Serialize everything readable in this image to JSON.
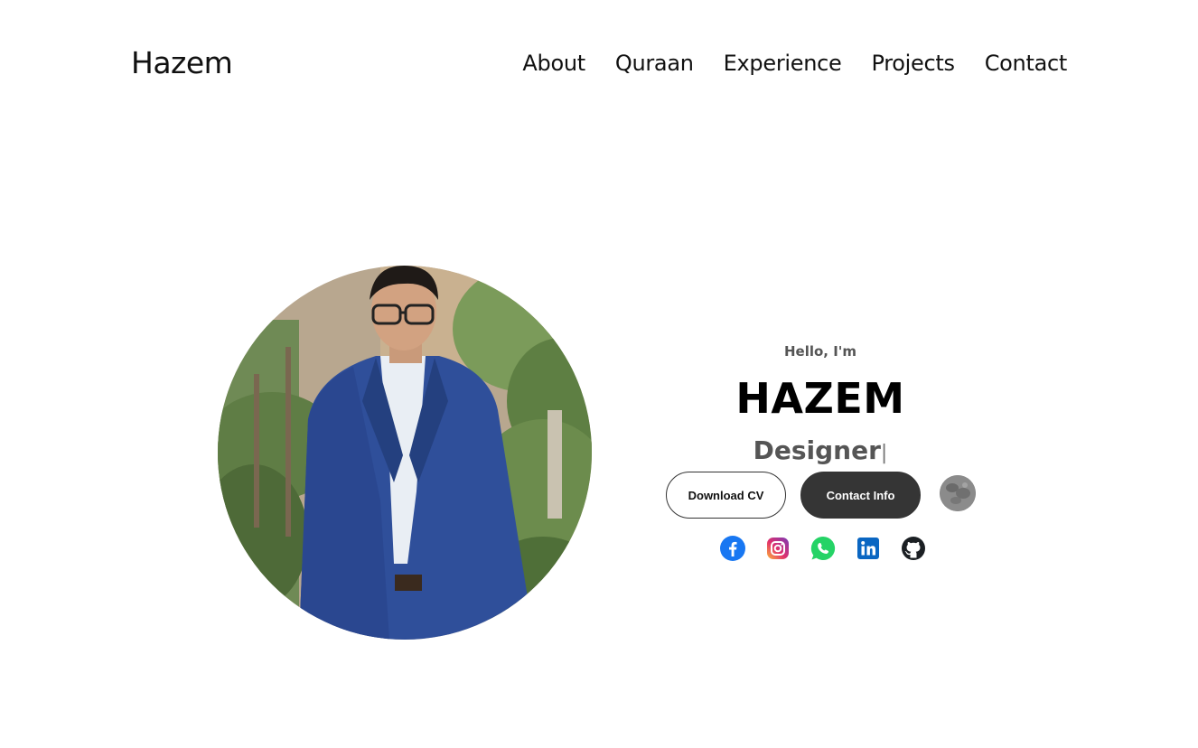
{
  "header": {
    "logo": "Hazem",
    "nav": [
      "About",
      "Quraan",
      "Experience",
      "Projects",
      "Contact"
    ]
  },
  "hero": {
    "greeting": "Hello, I'm",
    "name": "HAZEM",
    "role": "Designer",
    "cursor": "|",
    "buttons": {
      "download_cv": "Download CV",
      "contact_info": "Contact Info"
    },
    "theme_toggle_icon": "moon-icon",
    "socials": [
      {
        "icon": "facebook-icon",
        "color": "#1877f2"
      },
      {
        "icon": "instagram-icon",
        "color": "#e1306c"
      },
      {
        "icon": "whatsapp-icon",
        "color": "#25d366"
      },
      {
        "icon": "linkedin-icon",
        "color": "#0a66c2"
      },
      {
        "icon": "github-icon",
        "color": "#1b1f23"
      }
    ]
  },
  "colors": {
    "text": "#111111",
    "muted": "#555555",
    "button_dark": "#353535",
    "background": "#ffffff"
  }
}
